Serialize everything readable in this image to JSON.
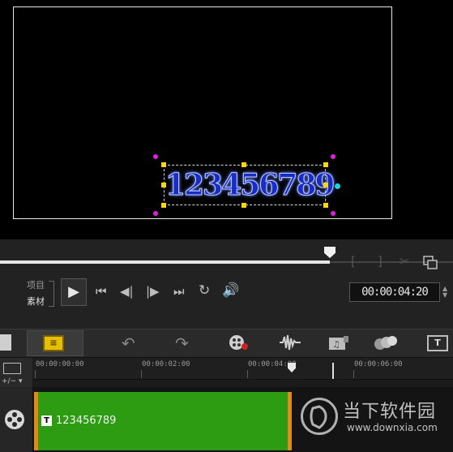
{
  "preview": {
    "overlay_text": "123456789"
  },
  "player": {
    "mode_options": [
      "项目",
      "素材"
    ],
    "timecode": "00:00:04:20",
    "icons": {
      "mark_in": "bracket-left-icon",
      "mark_out": "bracket-right-icon",
      "split": "scissors-icon",
      "enlarge": "enlarge-preview-icon",
      "play": "play-icon",
      "home": "go-to-start-icon",
      "prev": "previous-frame-icon",
      "next": "next-frame-icon",
      "end": "go-to-end-icon",
      "repeat": "repeat-icon",
      "volume": "volume-icon"
    },
    "progress": 0.73
  },
  "toolbar": {
    "icons": [
      "storyboard-view-icon",
      "timeline-view-icon",
      "undo-icon",
      "redo-icon",
      "record-capture-icon",
      "sound-mixer-icon",
      "auto-music-icon",
      "motion-tracking-icon",
      "subtitle-editor-icon"
    ]
  },
  "ruler": {
    "labels": [
      "00:00:00:00",
      "00:00:02:00",
      "00:00:04:00",
      "00:00:06:00"
    ]
  },
  "track": {
    "clip_label": "123456789",
    "clip_color": "#2e9c12",
    "clip_edge_color": "#e08a1a"
  },
  "watermark": {
    "name": "当下软件园",
    "url": "www.downxia.com"
  }
}
